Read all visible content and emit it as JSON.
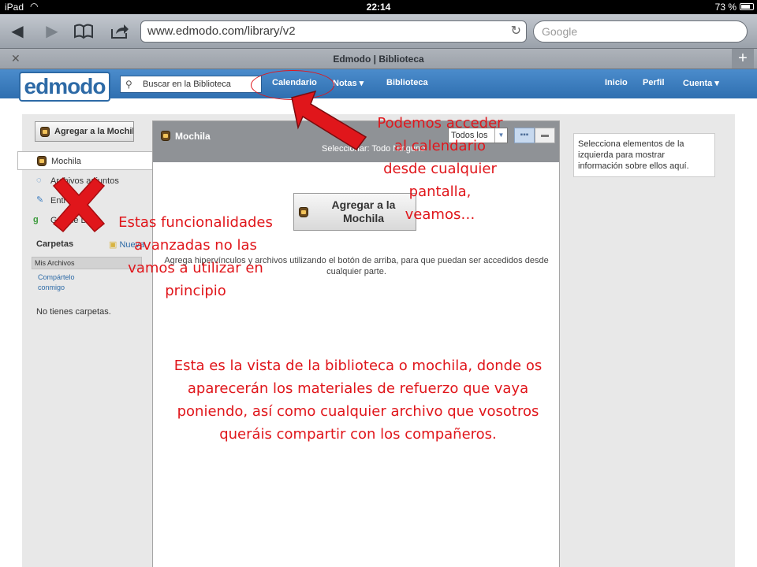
{
  "statusbar": {
    "device": "iPad",
    "time": "22:14",
    "battery": "73 %"
  },
  "browser": {
    "url": "www.edmodo.com/library/v2",
    "search_placeholder": "Google",
    "tab_title": "Edmodo | Biblioteca"
  },
  "nav": {
    "logo": "edmodo",
    "search_placeholder": "Buscar en la Biblioteca",
    "items": {
      "calendar": "Calendario",
      "notes": "Notas ▾",
      "library": "Biblioteca",
      "home": "Inicio",
      "profile": "Perfil",
      "account": "Cuenta ▾"
    }
  },
  "sidebar": {
    "add_button": "Agregar a la Mochila",
    "items": [
      {
        "label": "Mochila"
      },
      {
        "label": "Archivos adjuntos"
      },
      {
        "label": "Entr"
      },
      {
        "label": "Google D"
      }
    ],
    "folders_title": "Carpetas",
    "new_folder": "Nueva",
    "my_files": "Mis Archivos",
    "shared_with_me": "Compártelo conmigo",
    "no_folders": "No tienes carpetas."
  },
  "panel": {
    "title": "Mochila",
    "filter": "Todos los",
    "select_row": "Seleccionar: Todo Ninguno",
    "big_add": "Agregar a la Mochila",
    "hint": "Agrega hipervínculos y archivos utilizando el botón de arriba, para que puedan ser accedidos desde cualquier parte."
  },
  "info_box": "Selecciona elementos de la izquierda para mostrar información sobre ellos aquí.",
  "annotations": {
    "calendar": "Podemos acceder al calendario desde cualquier pantalla, veamos…",
    "advanced": "Estas funcionalidades avanzadas no las vamos a utilizar en principio",
    "library": "Esta es la vista de la biblioteca o mochila, donde os aparecerán los materiales de refuerzo que vaya poniendo, así como cualquier archivo que vosotros queráis compartir con los compañeros.",
    "color": "#e0161b"
  }
}
